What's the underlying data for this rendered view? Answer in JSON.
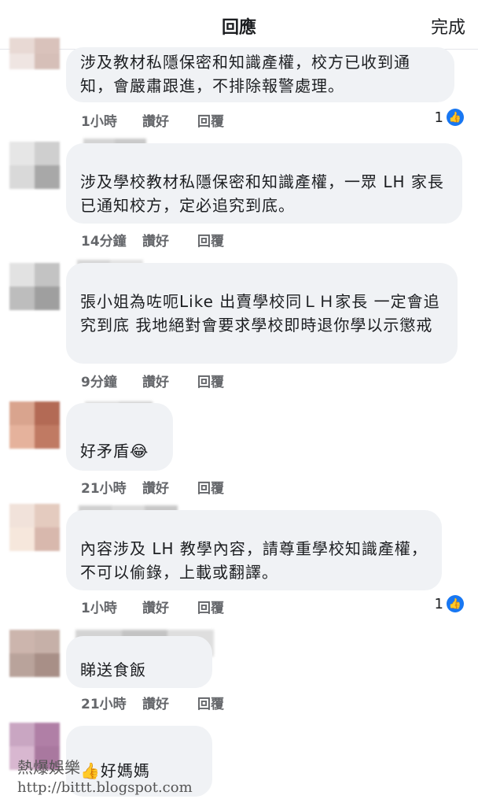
{
  "header": {
    "title": "回應",
    "done_label": "完成"
  },
  "actions": {
    "like": "讚好",
    "reply": "回覆"
  },
  "comments": [
    {
      "text": "涉及教材私隱保密和知識產權，校方已收到通知，會嚴肅跟進，不排除報警處理。",
      "time": "1小時",
      "reactions": "1"
    },
    {
      "text": "涉及學校教材私隱保密和知識產權，一眾 LH 家長已通知校方，定必追究到底。",
      "time": "14分鐘"
    },
    {
      "text": "張小姐為咗呃Like 出賣學校同ＬＨ家長 一定會追究到底 我地絕對會要求學校即時退你學以示懲戒",
      "time": "9分鐘"
    },
    {
      "text": "好矛盾",
      "time": "21小時",
      "emoji": "😂"
    },
    {
      "text": "內容涉及 LH 教學內容，請尊重學校知識產權，不可以偷錄，上載或翻譯。",
      "time": "1小時",
      "reactions": "1"
    },
    {
      "text": "睇送食飯",
      "time": "21小時"
    },
    {
      "text": "好媽媽",
      "emoji": "👍"
    }
  ],
  "watermark": {
    "line1": "熱爆娛樂",
    "line2": "http://bittt.blogspot.com"
  }
}
